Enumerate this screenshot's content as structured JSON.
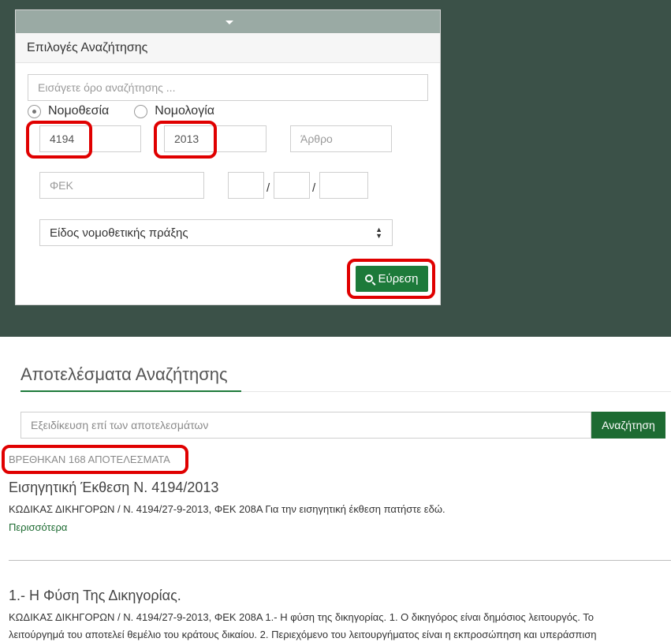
{
  "search_panel": {
    "title": "Επιλογές Αναζήτησης",
    "term_placeholder": "Εισάγετε όρο αναζήτησης ...",
    "radio_legislation": "Νομοθεσία",
    "radio_case_law": "Νομολογία",
    "radio_selected": "Νομοθεσία",
    "law_number": "4194",
    "year": "2013",
    "article_placeholder": "Άρθρο",
    "fek_placeholder": "ΦΕΚ",
    "date_separator": "/",
    "act_type": "Είδος νομοθετικής πράξης",
    "find_button": "Εύρεση"
  },
  "results": {
    "title": "Αποτελέσματα Αναζήτησης",
    "refine_placeholder": "Εξειδίκευση επί των αποτελεσμάτων",
    "refine_button": "Αναζήτηση",
    "found_text": "ΒΡΕΘΗΚΑΝ 168 ΑΠΟΤΕΛΕΣΜΑΤΑ",
    "items": [
      {
        "title": "Εισηγητική Έκθεση Ν. 4194/2013",
        "line1": "ΚΩΔΙΚΑΣ ΔΙΚΗΓΟΡΩΝ / Ν. 4194/27-9-2013, ΦΕΚ 208Α   Για την εισηγητική έκθεση πατήστε εδώ.",
        "more": "Περισσότερα"
      },
      {
        "title": "1.- Η Φύση Της Δικηγορίας.",
        "line1": "ΚΩΔΙΚΑΣ ΔΙΚΗΓΟΡΩΝ / Ν. 4194/27-9-2013, ΦΕΚ 208Α   1.- Η φύση της δικηγορίας. 1. Ο δικηγόρος είναι δημόσιος λειτουργός. Το",
        "line2": "λειτούργημά του αποτελεί θεμέλιο του κράτους δικαίου.   2. Περιεχόμενο του λειτουργήματος είναι η εκπροσώπηση και υπεράσπιση"
      }
    ]
  },
  "colors": {
    "band": "#3b5148",
    "accent_green": "#1d7a3a",
    "highlight_red": "#e00000"
  }
}
